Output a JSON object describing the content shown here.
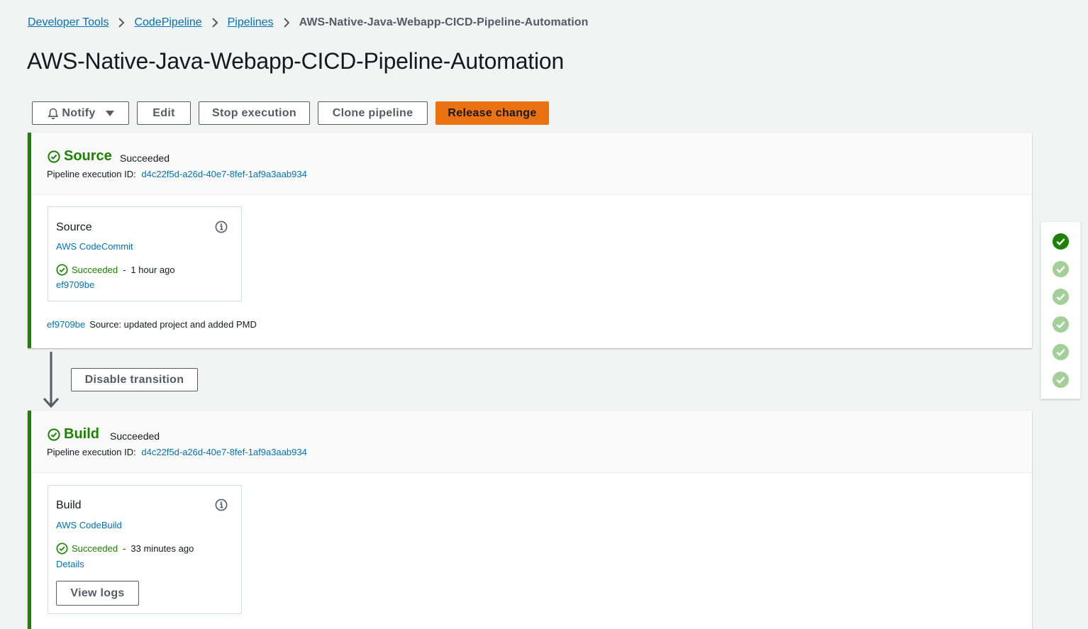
{
  "breadcrumb": {
    "items": [
      "Developer Tools",
      "CodePipeline",
      "Pipelines"
    ],
    "current": "AWS-Native-Java-Webapp-CICD-Pipeline-Automation"
  },
  "page": {
    "title": "AWS-Native-Java-Webapp-CICD-Pipeline-Automation"
  },
  "toolbar": {
    "notify": "Notify",
    "edit": "Edit",
    "stop": "Stop execution",
    "clone": "Clone pipeline",
    "release": "Release change"
  },
  "stages": [
    {
      "name": "Source",
      "status": "Succeeded",
      "exec_label": "Pipeline execution ID:",
      "exec_id": "d4c22f5d-a26d-40e7-8fef-1af9a3aab934",
      "action": {
        "title": "Source",
        "provider": "AWS CodeCommit",
        "status": "Succeeded",
        "time": "1 hour ago",
        "link": "ef9709be"
      },
      "commit": {
        "id": "ef9709be",
        "message": "Source: updated project and added PMD"
      }
    },
    {
      "name": "Build",
      "status": "Succeeded",
      "exec_label": "Pipeline execution ID:",
      "exec_id": "d4c22f5d-a26d-40e7-8fef-1af9a3aab934",
      "action": {
        "title": "Build",
        "provider": "AWS CodeBuild",
        "status": "Succeeded",
        "time": "33 minutes ago",
        "link": "Details",
        "button": "View logs"
      }
    }
  ],
  "transition": {
    "button": "Disable transition"
  },
  "side_panel": {
    "stage_count": 6,
    "active_index": 0
  },
  "colors": {
    "success": "#1d8102",
    "primary": "#ec7211",
    "link": "#0073bb",
    "side_inactive": "#a3cf98"
  }
}
